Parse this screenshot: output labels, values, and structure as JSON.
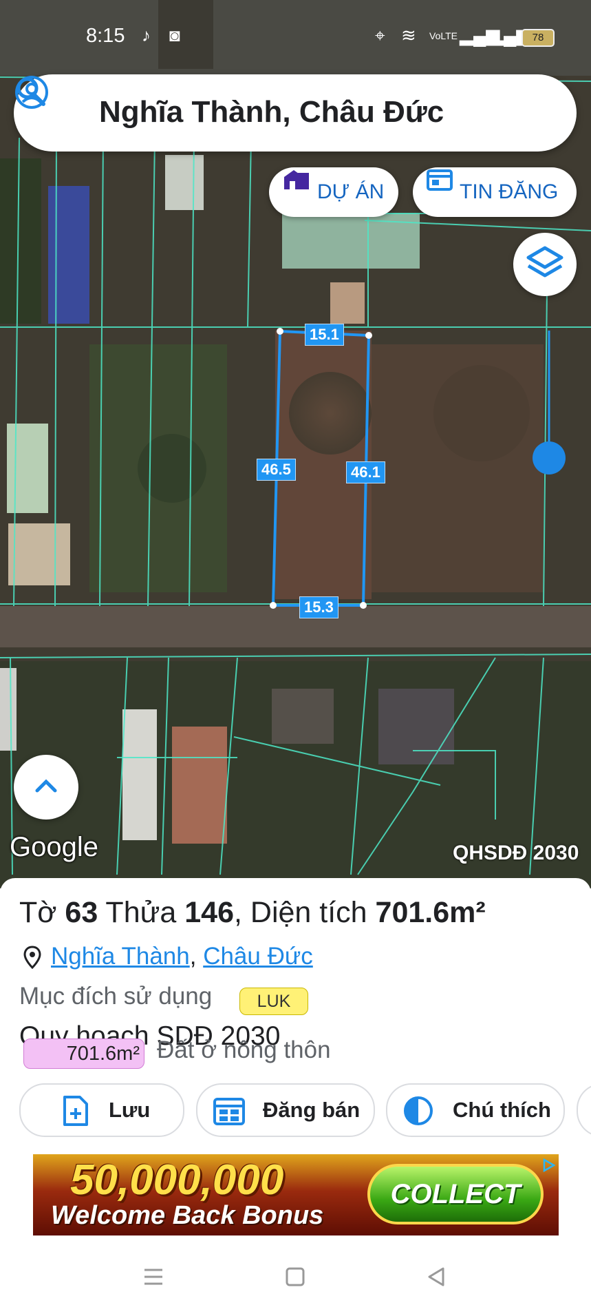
{
  "status_bar": {
    "time": "8:15",
    "battery": "78"
  },
  "search": {
    "query": "Nghĩa Thành, Châu Đức"
  },
  "chips": {
    "projects": "DỰ ÁN",
    "listings": "TIN ĐĂNG"
  },
  "map": {
    "google_label": "Google",
    "plan_layer_label": "QHSDĐ 2030",
    "plot_dimensions": {
      "top": "15.1",
      "left": "46.5",
      "right": "46.1",
      "bottom": "15.3"
    }
  },
  "details": {
    "sheet_prefix": "Tờ ",
    "sheet_no": "63",
    "parcel_prefix": " Thửa ",
    "parcel_no": "146",
    "area_prefix": ", Diện tích ",
    "area": "701.6m²",
    "location_ward": "Nghĩa Thành",
    "location_sep": ", ",
    "location_district": "Châu Đức",
    "usage_label": "Mục đích sử dụng",
    "usage_code": "LUK",
    "plan_title": "Quy hoạch SDĐ 2030",
    "plan_area": "701.6m²",
    "plan_land_type": "Đất ở nông thôn"
  },
  "actions": {
    "save": "Lưu",
    "post": "Đăng bán",
    "legend": "Chú thích"
  },
  "ad": {
    "amount": "50,000,000",
    "bonus_text": "Welcome Back Bonus",
    "cta": "COLLECT"
  },
  "colors": {
    "accent": "#1e88e5",
    "parcel_lines": "#4de8c8",
    "plot_outline": "#2196f3",
    "luk_badge": "#fff176",
    "area_badge": "#f3c1f5"
  }
}
